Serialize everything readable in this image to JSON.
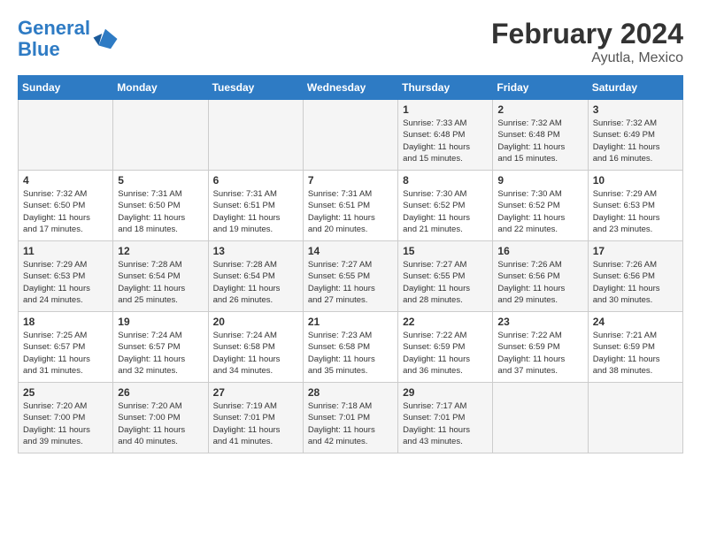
{
  "header": {
    "logo_general": "General",
    "logo_blue": "Blue",
    "month": "February 2024",
    "location": "Ayutla, Mexico"
  },
  "weekdays": [
    "Sunday",
    "Monday",
    "Tuesday",
    "Wednesday",
    "Thursday",
    "Friday",
    "Saturday"
  ],
  "weeks": [
    [
      {
        "day": "",
        "info": ""
      },
      {
        "day": "",
        "info": ""
      },
      {
        "day": "",
        "info": ""
      },
      {
        "day": "",
        "info": ""
      },
      {
        "day": "1",
        "info": "Sunrise: 7:33 AM\nSunset: 6:48 PM\nDaylight: 11 hours\nand 15 minutes."
      },
      {
        "day": "2",
        "info": "Sunrise: 7:32 AM\nSunset: 6:48 PM\nDaylight: 11 hours\nand 15 minutes."
      },
      {
        "day": "3",
        "info": "Sunrise: 7:32 AM\nSunset: 6:49 PM\nDaylight: 11 hours\nand 16 minutes."
      }
    ],
    [
      {
        "day": "4",
        "info": "Sunrise: 7:32 AM\nSunset: 6:50 PM\nDaylight: 11 hours\nand 17 minutes."
      },
      {
        "day": "5",
        "info": "Sunrise: 7:31 AM\nSunset: 6:50 PM\nDaylight: 11 hours\nand 18 minutes."
      },
      {
        "day": "6",
        "info": "Sunrise: 7:31 AM\nSunset: 6:51 PM\nDaylight: 11 hours\nand 19 minutes."
      },
      {
        "day": "7",
        "info": "Sunrise: 7:31 AM\nSunset: 6:51 PM\nDaylight: 11 hours\nand 20 minutes."
      },
      {
        "day": "8",
        "info": "Sunrise: 7:30 AM\nSunset: 6:52 PM\nDaylight: 11 hours\nand 21 minutes."
      },
      {
        "day": "9",
        "info": "Sunrise: 7:30 AM\nSunset: 6:52 PM\nDaylight: 11 hours\nand 22 minutes."
      },
      {
        "day": "10",
        "info": "Sunrise: 7:29 AM\nSunset: 6:53 PM\nDaylight: 11 hours\nand 23 minutes."
      }
    ],
    [
      {
        "day": "11",
        "info": "Sunrise: 7:29 AM\nSunset: 6:53 PM\nDaylight: 11 hours\nand 24 minutes."
      },
      {
        "day": "12",
        "info": "Sunrise: 7:28 AM\nSunset: 6:54 PM\nDaylight: 11 hours\nand 25 minutes."
      },
      {
        "day": "13",
        "info": "Sunrise: 7:28 AM\nSunset: 6:54 PM\nDaylight: 11 hours\nand 26 minutes."
      },
      {
        "day": "14",
        "info": "Sunrise: 7:27 AM\nSunset: 6:55 PM\nDaylight: 11 hours\nand 27 minutes."
      },
      {
        "day": "15",
        "info": "Sunrise: 7:27 AM\nSunset: 6:55 PM\nDaylight: 11 hours\nand 28 minutes."
      },
      {
        "day": "16",
        "info": "Sunrise: 7:26 AM\nSunset: 6:56 PM\nDaylight: 11 hours\nand 29 minutes."
      },
      {
        "day": "17",
        "info": "Sunrise: 7:26 AM\nSunset: 6:56 PM\nDaylight: 11 hours\nand 30 minutes."
      }
    ],
    [
      {
        "day": "18",
        "info": "Sunrise: 7:25 AM\nSunset: 6:57 PM\nDaylight: 11 hours\nand 31 minutes."
      },
      {
        "day": "19",
        "info": "Sunrise: 7:24 AM\nSunset: 6:57 PM\nDaylight: 11 hours\nand 32 minutes."
      },
      {
        "day": "20",
        "info": "Sunrise: 7:24 AM\nSunset: 6:58 PM\nDaylight: 11 hours\nand 34 minutes."
      },
      {
        "day": "21",
        "info": "Sunrise: 7:23 AM\nSunset: 6:58 PM\nDaylight: 11 hours\nand 35 minutes."
      },
      {
        "day": "22",
        "info": "Sunrise: 7:22 AM\nSunset: 6:59 PM\nDaylight: 11 hours\nand 36 minutes."
      },
      {
        "day": "23",
        "info": "Sunrise: 7:22 AM\nSunset: 6:59 PM\nDaylight: 11 hours\nand 37 minutes."
      },
      {
        "day": "24",
        "info": "Sunrise: 7:21 AM\nSunset: 6:59 PM\nDaylight: 11 hours\nand 38 minutes."
      }
    ],
    [
      {
        "day": "25",
        "info": "Sunrise: 7:20 AM\nSunset: 7:00 PM\nDaylight: 11 hours\nand 39 minutes."
      },
      {
        "day": "26",
        "info": "Sunrise: 7:20 AM\nSunset: 7:00 PM\nDaylight: 11 hours\nand 40 minutes."
      },
      {
        "day": "27",
        "info": "Sunrise: 7:19 AM\nSunset: 7:01 PM\nDaylight: 11 hours\nand 41 minutes."
      },
      {
        "day": "28",
        "info": "Sunrise: 7:18 AM\nSunset: 7:01 PM\nDaylight: 11 hours\nand 42 minutes."
      },
      {
        "day": "29",
        "info": "Sunrise: 7:17 AM\nSunset: 7:01 PM\nDaylight: 11 hours\nand 43 minutes."
      },
      {
        "day": "",
        "info": ""
      },
      {
        "day": "",
        "info": ""
      }
    ]
  ]
}
